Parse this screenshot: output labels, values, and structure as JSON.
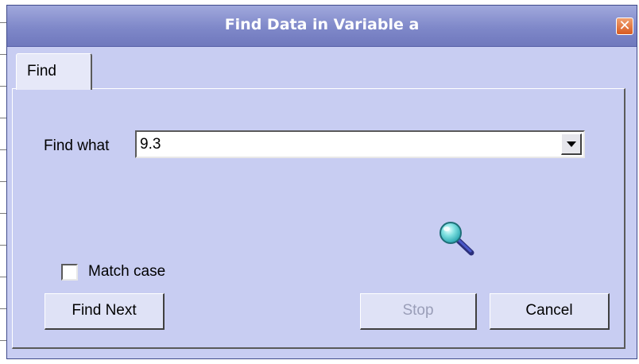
{
  "window": {
    "title": "Find Data in Variable a",
    "close_glyph": "✕"
  },
  "tabs": [
    {
      "label": "Find",
      "selected": true
    }
  ],
  "find": {
    "label": "Find what",
    "value": "9.3"
  },
  "options": {
    "match_case_label": "Match case",
    "match_case_checked": false
  },
  "buttons": {
    "find_next": "Find Next",
    "stop": "Stop",
    "stop_enabled": false,
    "cancel": "Cancel"
  },
  "icons": {
    "search": "magnifier-icon"
  },
  "colors": {
    "title_bar": "#7f88c9",
    "dialog_bg": "#c8cdf2",
    "close_button": "#e06a2c"
  }
}
